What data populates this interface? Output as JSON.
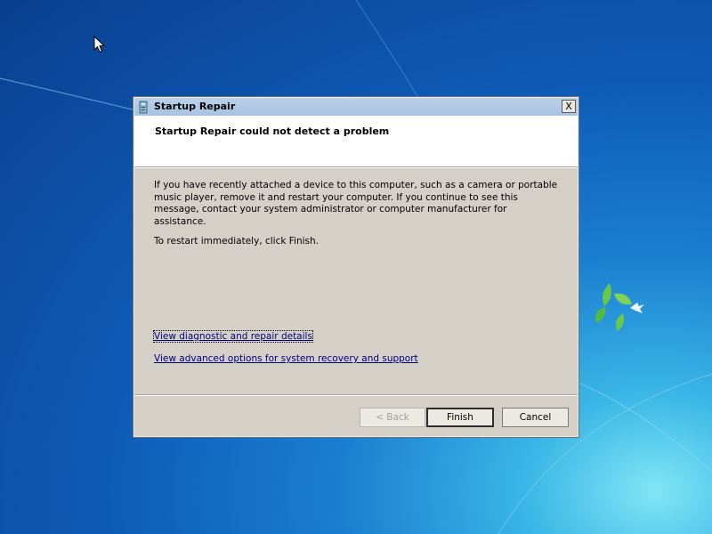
{
  "window": {
    "title": "Startup Repair",
    "close_glyph": "X"
  },
  "header": {
    "title": "Startup Repair could not detect a problem"
  },
  "body": {
    "message": "If you have recently attached a device to this computer, such as a camera or portable music player, remove it and restart your computer. If you continue to see this message, contact your system administrator or computer manufacturer for assistance.",
    "restart_note": "To restart immediately, click Finish."
  },
  "links": {
    "diagnostic": "View diagnostic and repair details",
    "advanced": "View advanced options for system recovery and support"
  },
  "buttons": {
    "back": "< Back",
    "finish": "Finish",
    "cancel": "Cancel"
  },
  "icons": {
    "title_icon": "startup-repair-icon",
    "cursor": "mouse-pointer-icon",
    "close": "close-icon"
  },
  "colors": {
    "link": "#00007f",
    "dialog_bg": "#d4d0c8",
    "titlebar": "#b9d1ea",
    "desktop": "#0e5cb8"
  }
}
